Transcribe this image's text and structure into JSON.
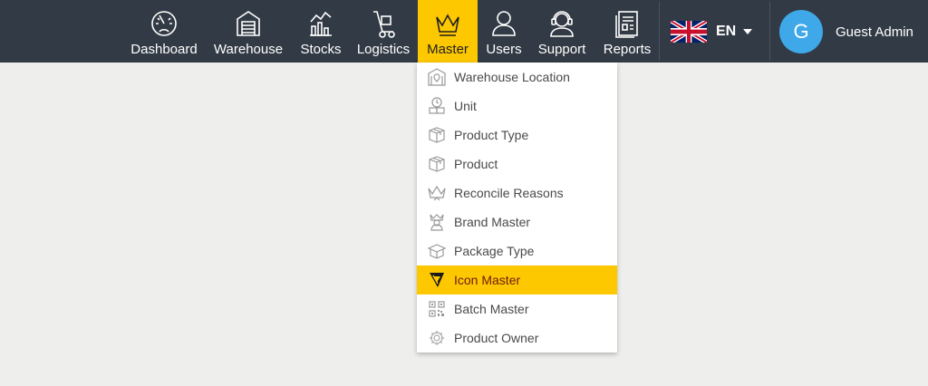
{
  "nav": {
    "items": [
      {
        "label": "Dashboard",
        "icon": "dashboard-gauge-icon"
      },
      {
        "label": "Warehouse",
        "icon": "warehouse-icon"
      },
      {
        "label": "Stocks",
        "icon": "stocks-chart-icon"
      },
      {
        "label": "Logistics",
        "icon": "hand-truck-icon"
      },
      {
        "label": "Master",
        "icon": "crown-icon",
        "active": true
      },
      {
        "label": "Users",
        "icon": "user-icon"
      },
      {
        "label": "Support",
        "icon": "headset-icon"
      },
      {
        "label": "Reports",
        "icon": "report-icon"
      }
    ]
  },
  "language": {
    "code": "EN",
    "flag": "uk-flag-icon"
  },
  "user": {
    "initial": "G",
    "name": "Guest Admin",
    "avatar_color": "#3ea8e8"
  },
  "dropdown": {
    "items": [
      {
        "label": "Warehouse Location",
        "icon": "warehouse-location-icon"
      },
      {
        "label": "Unit",
        "icon": "unit-scale-icon"
      },
      {
        "label": "Product Type",
        "icon": "box-icon"
      },
      {
        "label": "Product",
        "icon": "box-icon"
      },
      {
        "label": "Reconcile Reasons",
        "icon": "crown-icon"
      },
      {
        "label": "Brand Master",
        "icon": "brand-icon"
      },
      {
        "label": "Package Type",
        "icon": "package-icon"
      },
      {
        "label": "Icon Master",
        "icon": "icon-master-logo-icon",
        "active": true
      },
      {
        "label": "Batch Master",
        "icon": "qr-code-icon"
      },
      {
        "label": "Product Owner",
        "icon": "gear-icon"
      }
    ]
  },
  "colors": {
    "topbar": "#323b45",
    "accent": "#fdc800",
    "background": "#eeeeec"
  }
}
